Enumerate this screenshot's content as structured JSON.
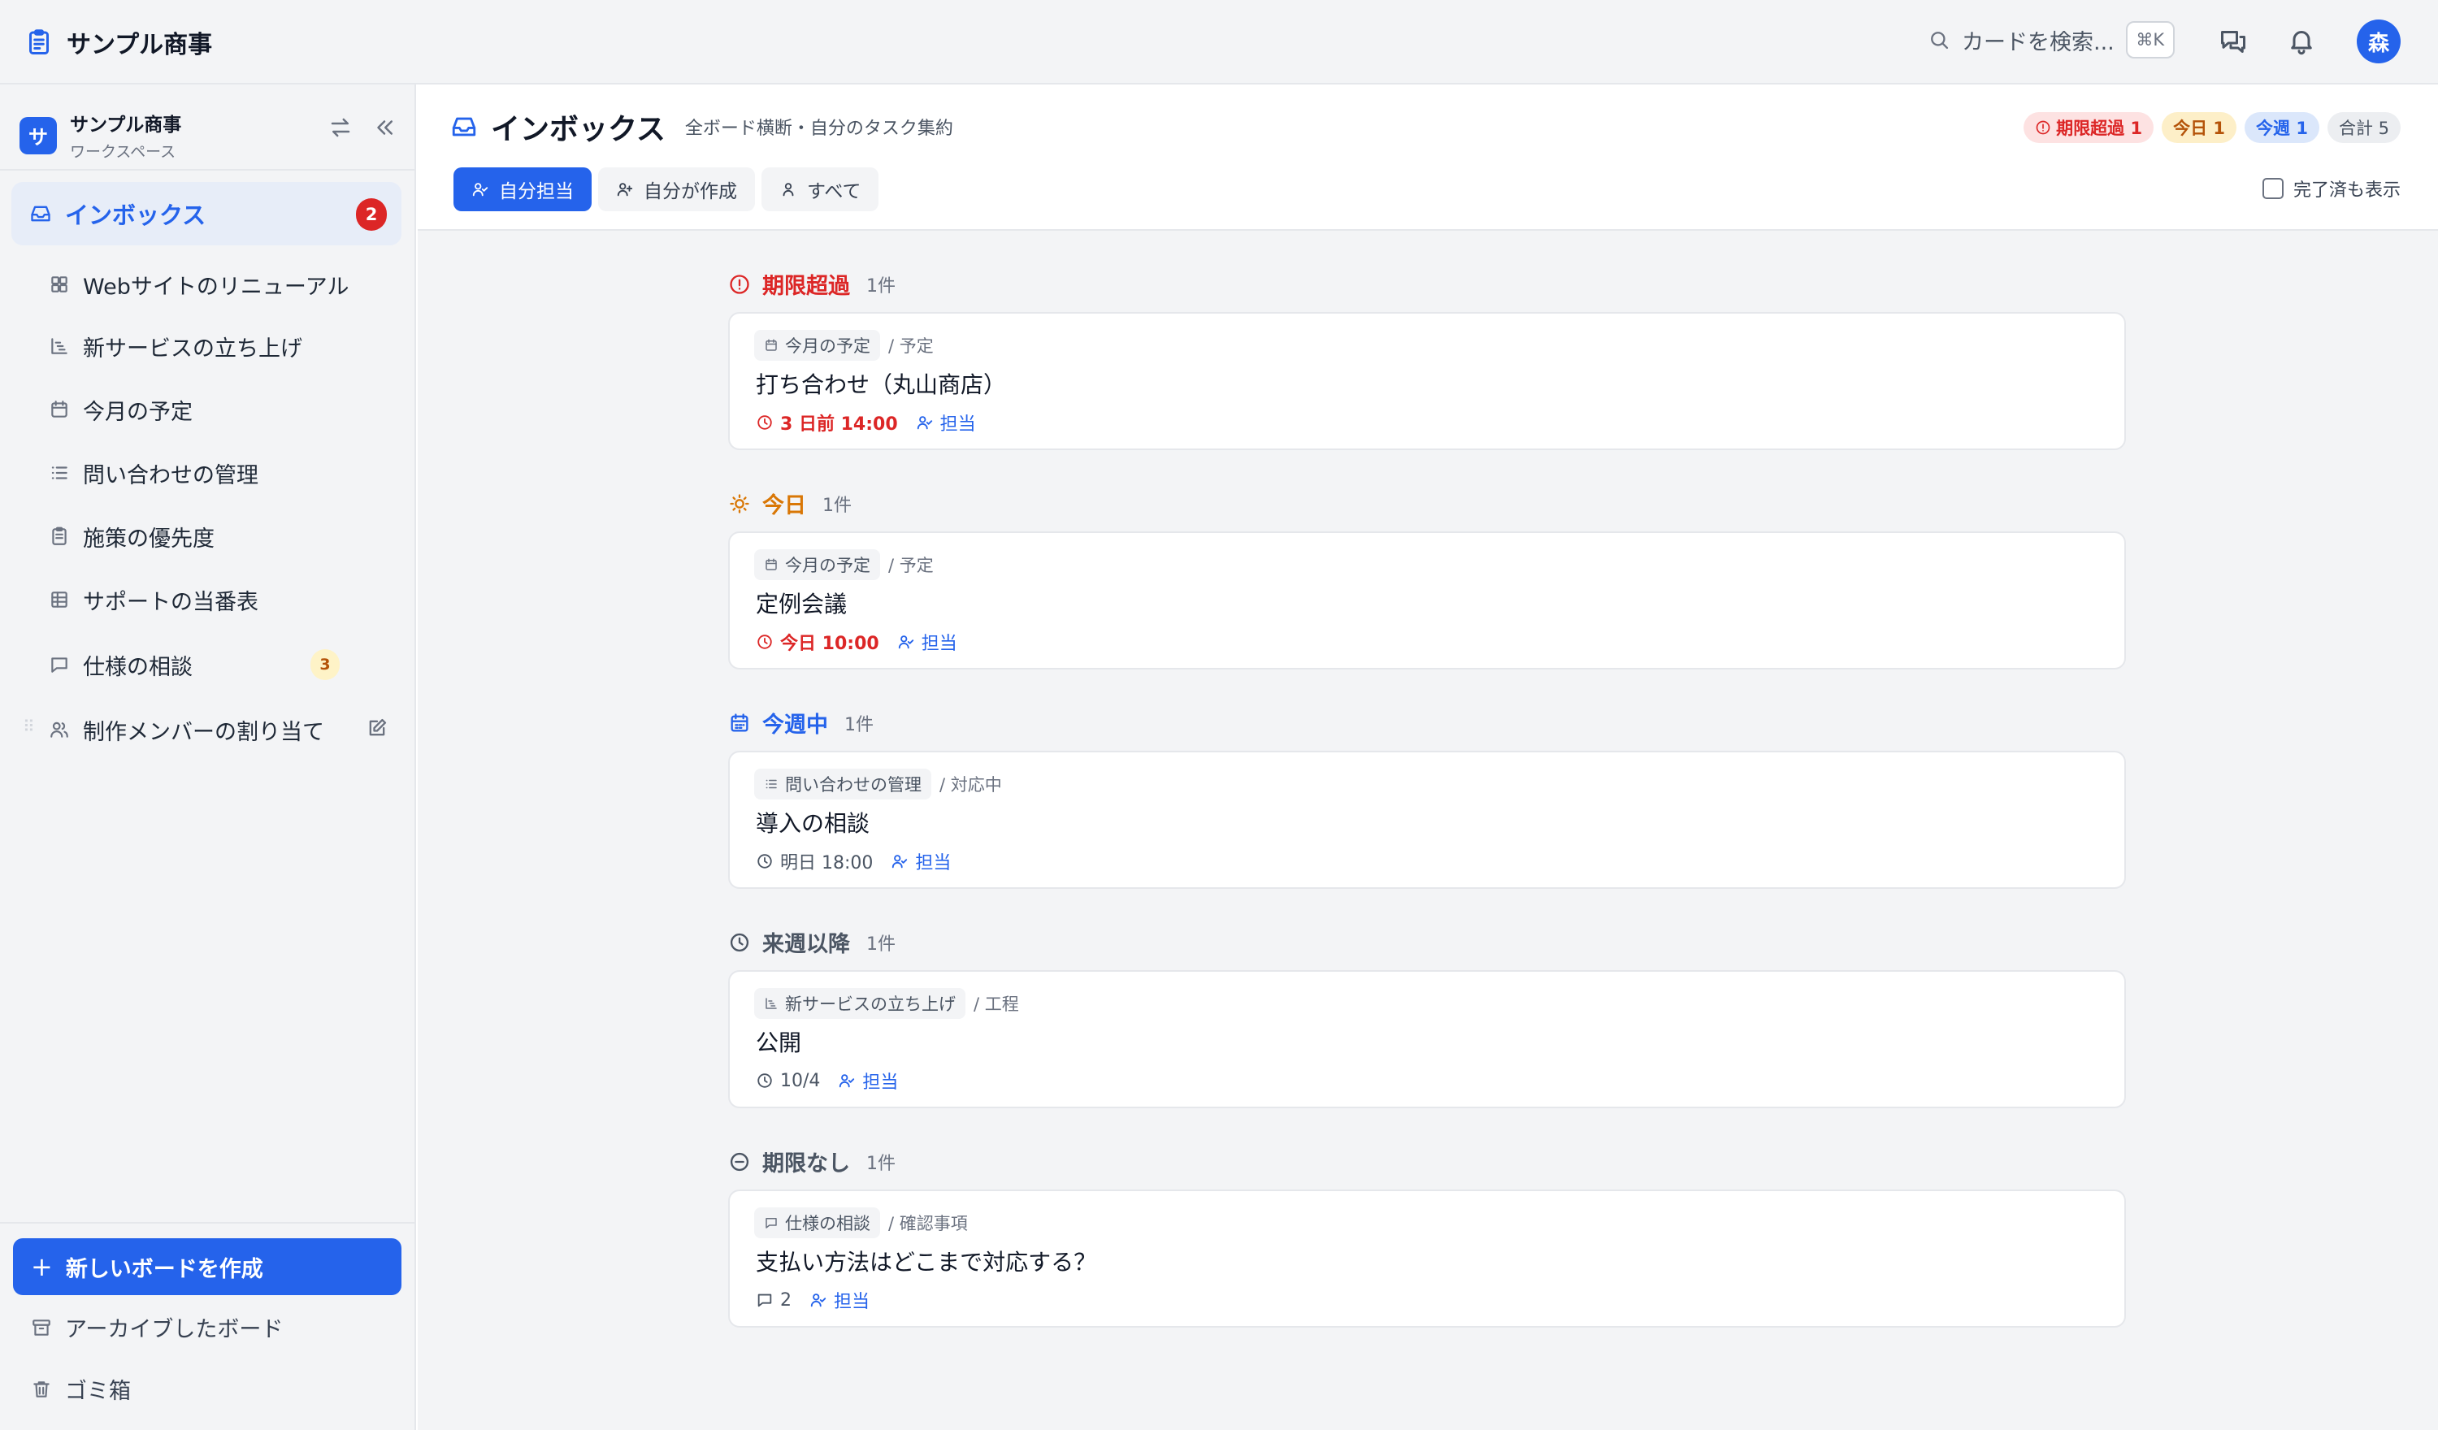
{
  "app": {
    "title": "サンプル商事"
  },
  "search": {
    "placeholder": "カードを検索...",
    "shortcut": "⌘K"
  },
  "user": {
    "avatar_initial": "森"
  },
  "workspace": {
    "badge": "サ",
    "name": "サンプル商事",
    "subtitle": "ワークスペース"
  },
  "sidebar": {
    "inbox": {
      "label": "インボックス",
      "count": "2"
    },
    "boards": [
      {
        "label": "Webサイトのリニューアル",
        "icon": "grid-icon"
      },
      {
        "label": "新サービスの立ち上げ",
        "icon": "gantt-icon"
      },
      {
        "label": "今月の予定",
        "icon": "calendar-icon"
      },
      {
        "label": "問い合わせの管理",
        "icon": "list-icon"
      },
      {
        "label": "施策の優先度",
        "icon": "clipboard-icon"
      },
      {
        "label": "サポートの当番表",
        "icon": "table-icon"
      },
      {
        "label": "仕様の相談",
        "icon": "chat-icon",
        "badge": "3"
      },
      {
        "label": "制作メンバーの割り当て",
        "icon": "users-icon"
      }
    ],
    "new_board": "新しいボードを作成",
    "archived": "アーカイブしたボード",
    "trash": "ゴミ箱"
  },
  "header": {
    "title": "インボックス",
    "subtitle": "全ボード横断・自分のタスク集約",
    "chips": {
      "overdue": "期限超過 1",
      "today": "今日 1",
      "week": "今週 1",
      "total": "合計 5"
    },
    "tabs": [
      "自分担当",
      "自分が作成",
      "すべて"
    ],
    "show_completed": "完了済も表示"
  },
  "sections": [
    {
      "name": "期限超過",
      "count": "1件",
      "cards": [
        {
          "board": "今月の予定",
          "column": "/ 予定",
          "title": "打ち合わせ（丸山商店）",
          "due": "3 日前 14:00",
          "assignee": "担当"
        }
      ]
    },
    {
      "name": "今日",
      "count": "1件",
      "cards": [
        {
          "board": "今月の予定",
          "column": "/ 予定",
          "title": "定例会議",
          "due": "今日 10:00",
          "assignee": "担当"
        }
      ]
    },
    {
      "name": "今週中",
      "count": "1件",
      "cards": [
        {
          "board": "問い合わせの管理",
          "column": "/ 対応中",
          "title": "導入の相談",
          "due": "明日 18:00",
          "assignee": "担当"
        }
      ]
    },
    {
      "name": "来週以降",
      "count": "1件",
      "cards": [
        {
          "board": "新サービスの立ち上げ",
          "column": "/ 工程",
          "title": "公開",
          "due": "10/4",
          "assignee": "担当"
        }
      ]
    },
    {
      "name": "期限なし",
      "count": "1件",
      "cards": [
        {
          "board": "仕様の相談",
          "column": "/ 確認事項",
          "title": "支払い方法はどこまで対応する？",
          "comments": "2",
          "assignee": "担当"
        }
      ]
    }
  ],
  "colors": {
    "accent": "#2563eb",
    "overdue": "#dc2626",
    "today": "#d97706",
    "week": "#2563eb",
    "muted": "#6b7280"
  }
}
